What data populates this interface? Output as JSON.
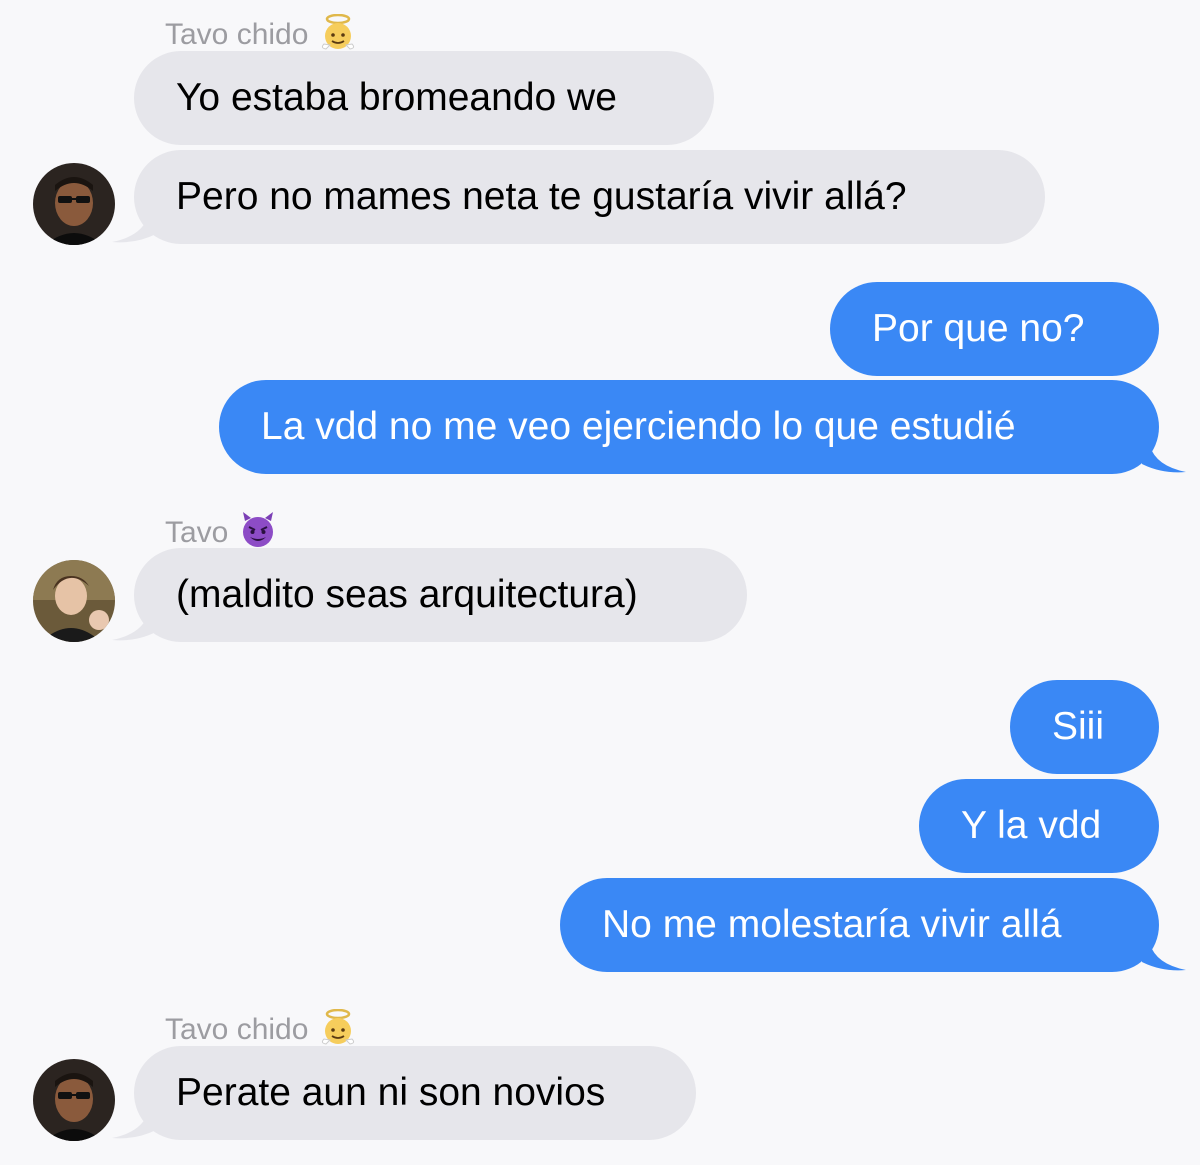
{
  "conversation": {
    "sender1_name": "Tavo chido",
    "sender1_emoji_icon": "angel-face-icon",
    "sender2_name": "Tavo",
    "sender2_emoji_icon": "smiling-devil-icon",
    "msg1": "Yo estaba bromeando we",
    "msg2": "Pero no mames neta te gustaría vivir allá?",
    "msg3": "Por que no?",
    "msg4": "La vdd no me veo ejerciendo lo que estudié",
    "msg5": "(maldito seas arquitectura)",
    "msg6": "Siii",
    "msg7": "Y la vdd",
    "msg8": "No me molestaría vivir allá",
    "sender3_name": "Tavo chido",
    "msg9": "Perate aun ni son novios"
  },
  "colors": {
    "incoming_bubble": "#e6e6eb",
    "outgoing_bubble": "#3a88f5",
    "sender_label": "#9c9ca1",
    "background": "#f8f8fa"
  }
}
